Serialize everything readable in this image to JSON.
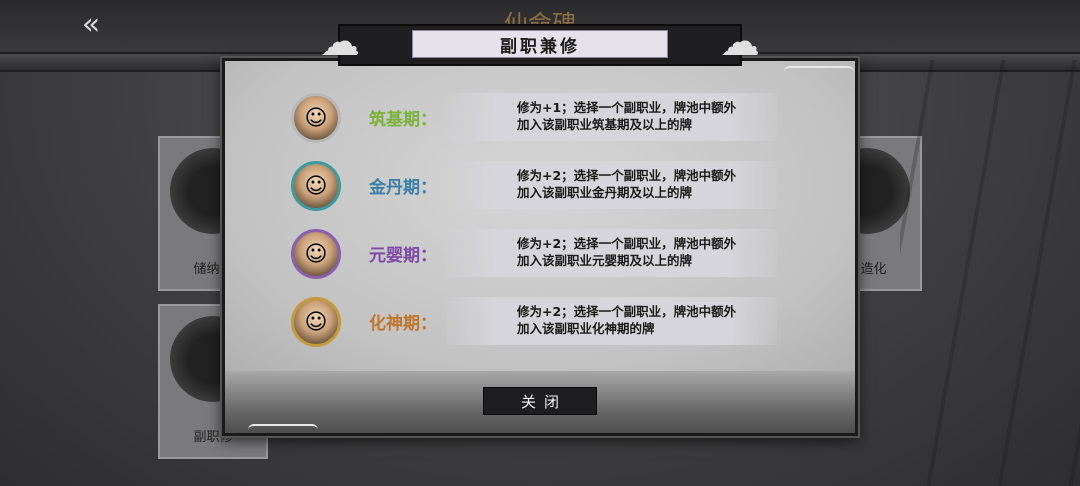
{
  "background": {
    "title": "仙命碑",
    "back_icon": "double-arrow-left-icon",
    "cards": [
      {
        "label": "储纳篆"
      },
      {
        "label": "缘造化"
      },
      {
        "label": "副职修"
      }
    ]
  },
  "dialog": {
    "title": "副职兼修",
    "rows": [
      {
        "stage": "筑基期：",
        "color": "#7ab23a",
        "ring": "#b8b8b8",
        "description": "修为+1；选择一个副职业，牌池中额外加入该副职业筑基期及以上的牌"
      },
      {
        "stage": "金丹期：",
        "color": "#3c7fa8",
        "ring": "#3d9aa0",
        "description": "修为+2；选择一个副职业，牌池中额外加入该副职业金丹期及以上的牌"
      },
      {
        "stage": "元婴期：",
        "color": "#7e4aa8",
        "ring": "#8a5fb0",
        "description": "修为+2；选择一个副职业，牌池中额外加入该副职业元婴期及以上的牌"
      },
      {
        "stage": "化神期：",
        "color": "#c0762a",
        "ring": "#c59a3a",
        "description": "修为+2；选择一个副职业，牌池中额外加入该副职业化神期的牌"
      }
    ],
    "close_label": "关闭"
  }
}
